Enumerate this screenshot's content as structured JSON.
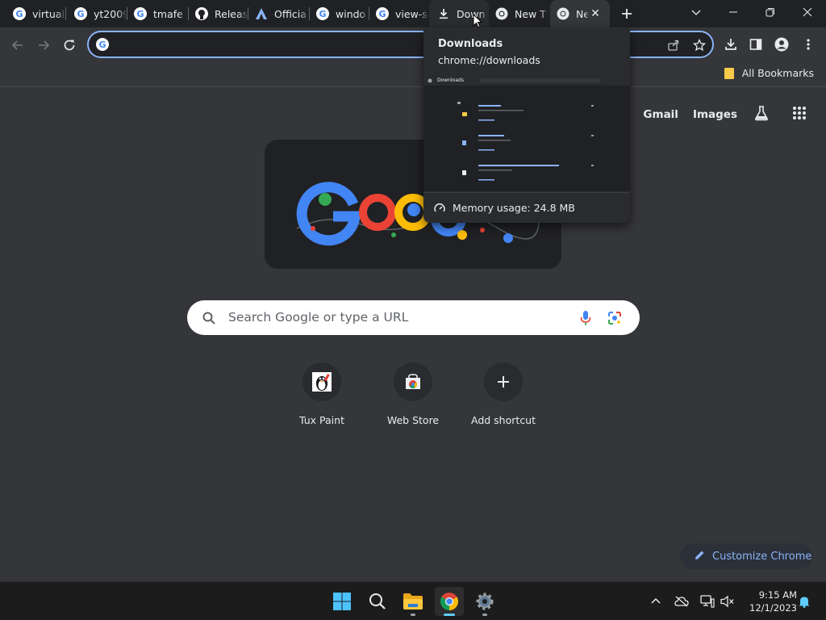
{
  "tabs": [
    {
      "label": "virtual",
      "icon": "google-icon"
    },
    {
      "label": "yt2009",
      "icon": "google-icon"
    },
    {
      "label": "tmafe",
      "icon": "google-icon"
    },
    {
      "label": "Releas",
      "icon": "github-icon"
    },
    {
      "label": "Officia",
      "icon": "arch-logo-icon"
    },
    {
      "label": "windo",
      "icon": "google-icon"
    },
    {
      "label": "view-s",
      "icon": "google-icon"
    },
    {
      "label": "Down",
      "icon": "download-icon"
    },
    {
      "label": "New T",
      "icon": "chrome-icon"
    },
    {
      "label": "Ne",
      "icon": "chrome-icon"
    }
  ],
  "bookmarks_bar": {
    "all_bookmarks": "All Bookmarks"
  },
  "ntp": {
    "gmail": "Gmail",
    "images": "Images",
    "search_placeholder": "Search Google or type a URL",
    "shortcuts": [
      {
        "label": "Tux Paint"
      },
      {
        "label": "Web Store"
      },
      {
        "label": "Add shortcut"
      }
    ],
    "customize": "Customize Chrome"
  },
  "hovercard": {
    "title": "Downloads",
    "url": "chrome://downloads",
    "memory": "Memory usage: 24.8 MB",
    "thumb_header": "Downloads"
  },
  "clock": {
    "time": "9:15 AM",
    "date": "12/1/2023"
  },
  "colors": {
    "accent": "#8ab4f8",
    "taskbar_active": "#60cdff"
  }
}
